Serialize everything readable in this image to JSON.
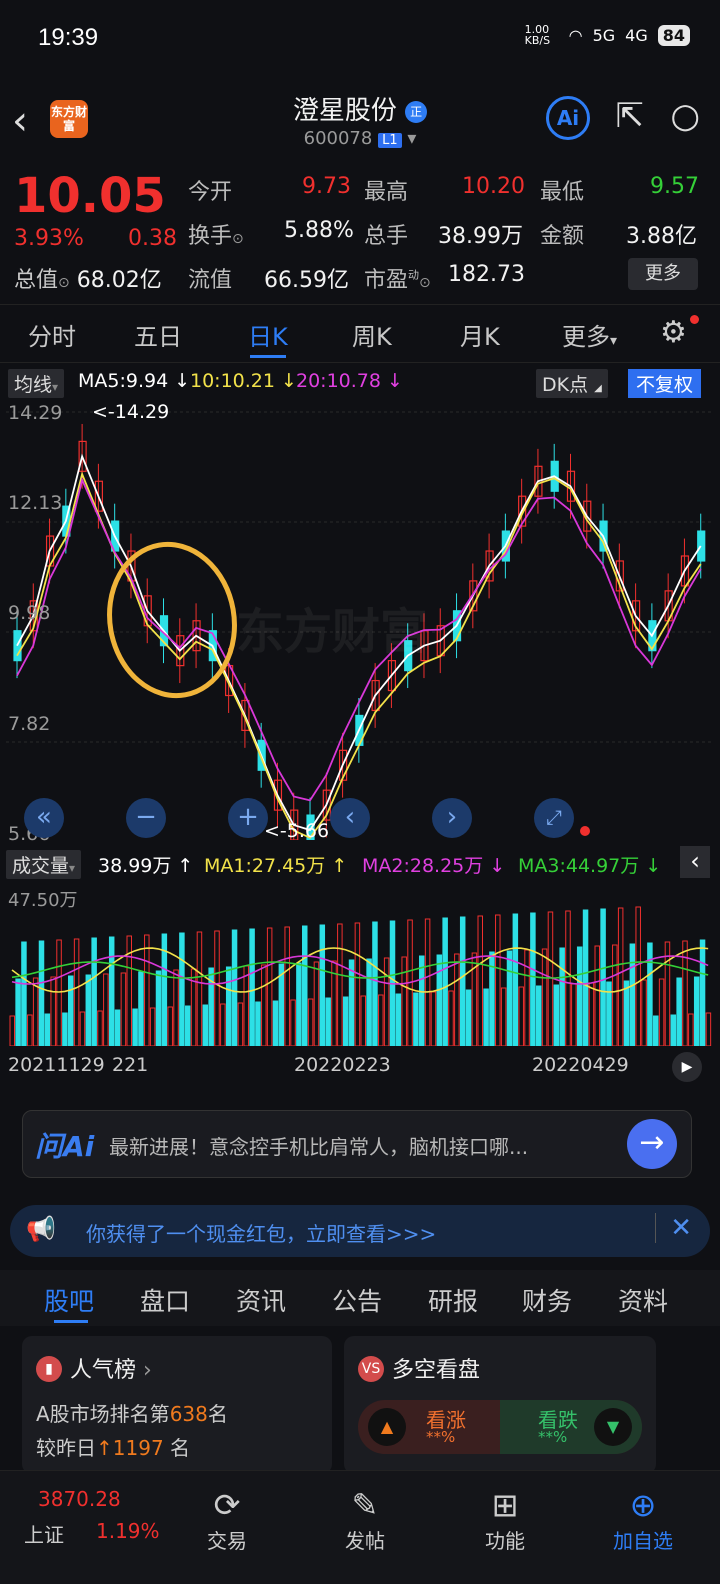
{
  "status": {
    "time": "19:39",
    "speed": "1.00 KB/S",
    "net1": "5G",
    "net2": "4G",
    "battery": "84"
  },
  "header": {
    "logo": "东方财富",
    "name": "澄星股份",
    "badge": "正",
    "code": "600078",
    "level": "L1"
  },
  "quote": {
    "price": "10.05",
    "pct": "3.93%",
    "change": "0.38",
    "open_k": "今开",
    "open_v": "9.73",
    "high_k": "最高",
    "high_v": "10.20",
    "low_k": "最低",
    "low_v": "9.57",
    "turn_k": "换手",
    "turn_v": "5.88%",
    "vol_k": "总手",
    "vol_v": "38.99万",
    "amt_k": "金额",
    "amt_v": "3.88亿",
    "mcap_k": "总值",
    "mcap_v": "68.02亿",
    "float_k": "流值",
    "float_v": "66.59亿",
    "pe_k": "市盈",
    "pe_sup": "动",
    "pe_v": "182.73",
    "more": "更多"
  },
  "tabs": [
    "分时",
    "五日",
    "日K",
    "周K",
    "月K",
    "更多"
  ],
  "ma": {
    "select": "均线",
    "ma5": "MA5:9.94 ↓",
    "ma10": "10:10.21 ↓",
    "ma20": "20:10.78 ↓",
    "dk": "DK点",
    "fuquan": "不复权"
  },
  "chart_data": {
    "type": "candlestick",
    "y_ticks": [
      "14.29",
      "12.13",
      "9.98",
      "7.82",
      "5.66"
    ],
    "max_label": "<-14.29",
    "min_label": "<-5.66",
    "watermark": "东方财富"
  },
  "vol": {
    "select": "成交量",
    "val": "38.99万 ↑",
    "ma1": "MA1:27.45万 ↑",
    "ma2": "MA2:28.25万 ↓",
    "ma3": "MA3:44.97万 ↓",
    "max": "47.50万"
  },
  "dates": [
    "20211129",
    "221",
    "20220223",
    "20220429"
  ],
  "ai": {
    "tag": "问Ai",
    "text": "最新进展！意念控手机比肩常人，脑机接口哪..."
  },
  "banner": {
    "text": "你获得了一个现金红包，立即查看>>>"
  },
  "tabs2": [
    "股吧",
    "盘口",
    "资讯",
    "公告",
    "研报",
    "财务",
    "资料"
  ],
  "card1": {
    "title": "人气榜",
    "line1a": "A股市场排名第",
    "rank": "638",
    "line1b": "名",
    "line2a": "较昨日",
    "up": "1197",
    "line2b": "名"
  },
  "card2": {
    "title": "多空看盘",
    "bull": "看涨",
    "bull_pct": "**%",
    "bear": "看跌",
    "bear_pct": "**%"
  },
  "bottom": {
    "index_val": "3870.28",
    "index_name": "上证",
    "index_pct": "1.19%",
    "trade": "交易",
    "post": "发帖",
    "func": "功能",
    "add": "加自选"
  }
}
